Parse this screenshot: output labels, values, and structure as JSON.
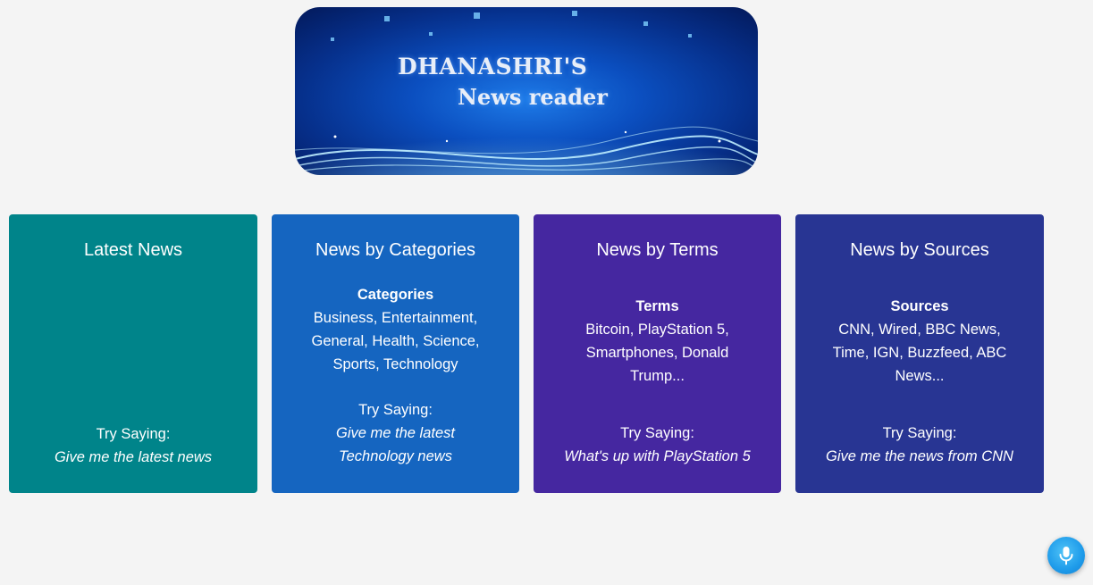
{
  "banner": {
    "title": "DHANASHRI'S",
    "subtitle": "News reader"
  },
  "cards": [
    {
      "title": "Latest News",
      "info_heading": "",
      "info_text": "",
      "try_label": "Try Saying:",
      "try_example": "Give me the latest news",
      "color": "#00848a"
    },
    {
      "title": "News by Categories",
      "info_heading": "Categories",
      "info_text": "Business, Entertainment, General, Health, Science, Sports, Technology",
      "try_label": "Try Saying:",
      "try_example": "Give me the latest Technology news",
      "color": "#1565c0"
    },
    {
      "title": "News by Terms",
      "info_heading": "Terms",
      "info_text": "Bitcoin, PlayStation 5, Smartphones, Donald Trump...",
      "try_label": "Try Saying:",
      "try_example": "What's up with PlayStation 5",
      "color": "#4527a0"
    },
    {
      "title": "News by Sources",
      "info_heading": "Sources",
      "info_text": "CNN, Wired, BBC News, Time, IGN, Buzzfeed, ABC News...",
      "try_label": "Try Saying:",
      "try_example": "Give me the news from CNN",
      "color": "#283593"
    }
  ],
  "mic_button": {
    "icon": "microphone-icon",
    "color": "#1e9bea"
  }
}
